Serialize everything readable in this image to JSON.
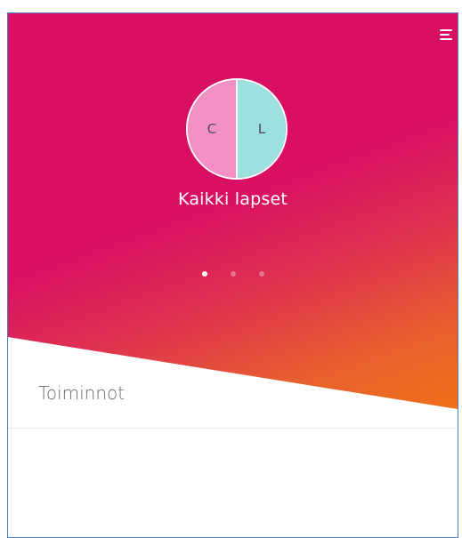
{
  "hero": {
    "avatar_left_initial": "C",
    "avatar_right_initial": "L",
    "title": "Kaikki lapset",
    "carousel_dots": 3,
    "active_dot": 0,
    "colors": {
      "gradient_start": "#d80f63",
      "gradient_end": "#ef7412",
      "avatar_left": "#f590c6",
      "avatar_right": "#9de0e0"
    }
  },
  "menu": {
    "icon": "hamburger-menu-icon"
  },
  "main": {
    "section_title": "Toiminnot"
  }
}
